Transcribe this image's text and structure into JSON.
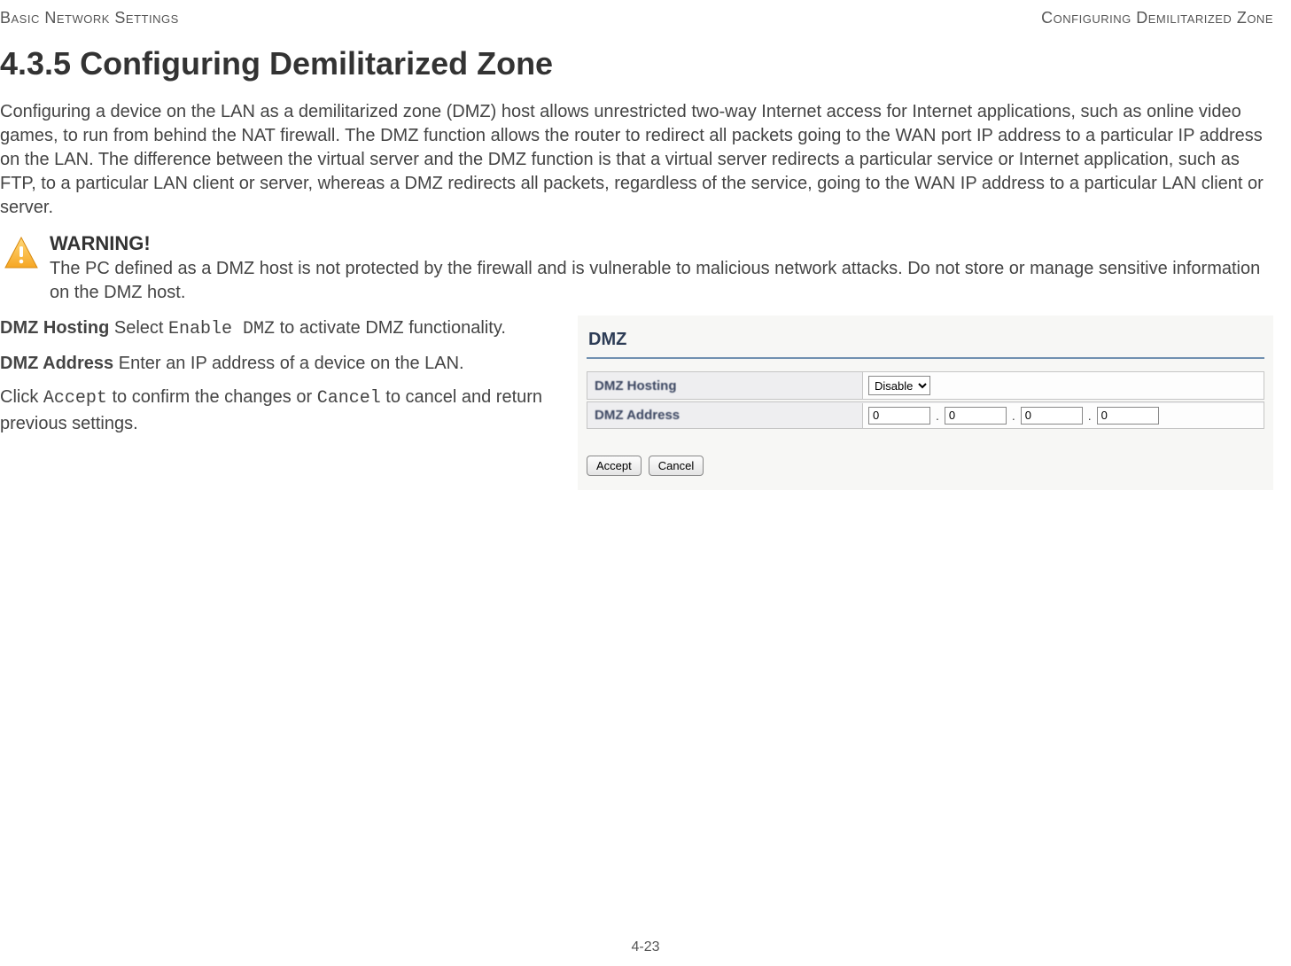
{
  "header": {
    "left": "Basic Network Settings",
    "right": "Configuring Demilitarized Zone"
  },
  "heading": "4.3.5 Configuring Demilitarized Zone",
  "intro": "Configuring a device on the LAN as a demilitarized zone (DMZ) host allows unrestricted two-way Internet access for Internet applications, such as online video games, to run from behind the NAT firewall. The DMZ function allows the router to redirect all packets going to the WAN port IP address to a particular IP address on the LAN. The difference between the virtual server and the DMZ function is that a virtual server redirects a particular service or Internet application, such as FTP, to a particular LAN client or server, whereas a DMZ redirects all packets, regardless of the service, going to the WAN IP address to a particular LAN client or server.",
  "warning": {
    "title": "WARNING!",
    "body": "The PC defined as a DMZ host is not protected by the firewall and is vulnerable to malicious network attacks. Do  not store or manage sensitive information on the DMZ host."
  },
  "fields": {
    "hosting": {
      "label": "DMZ Hosting",
      "desc_prefix": "  Select ",
      "code": "Enable DMZ",
      "desc_suffix": " to activate DMZ functionality."
    },
    "address": {
      "label": "DMZ Address",
      "desc": "  Enter an IP address of a device on the LAN."
    },
    "actions": {
      "prefix": "Click ",
      "accept": "Accept",
      "mid": "  to confirm the changes or ",
      "cancel": "Cancel",
      "suffix": " to cancel and return previous settings."
    }
  },
  "panel": {
    "title": "DMZ",
    "row_hosting_label": "DMZ Hosting",
    "row_address_label": "DMZ Address",
    "hosting_value": "Disable",
    "ip": {
      "a": "0",
      "b": "0",
      "c": "0",
      "d": "0"
    },
    "accept_btn": "Accept",
    "cancel_btn": "Cancel"
  },
  "footer": "4-23"
}
